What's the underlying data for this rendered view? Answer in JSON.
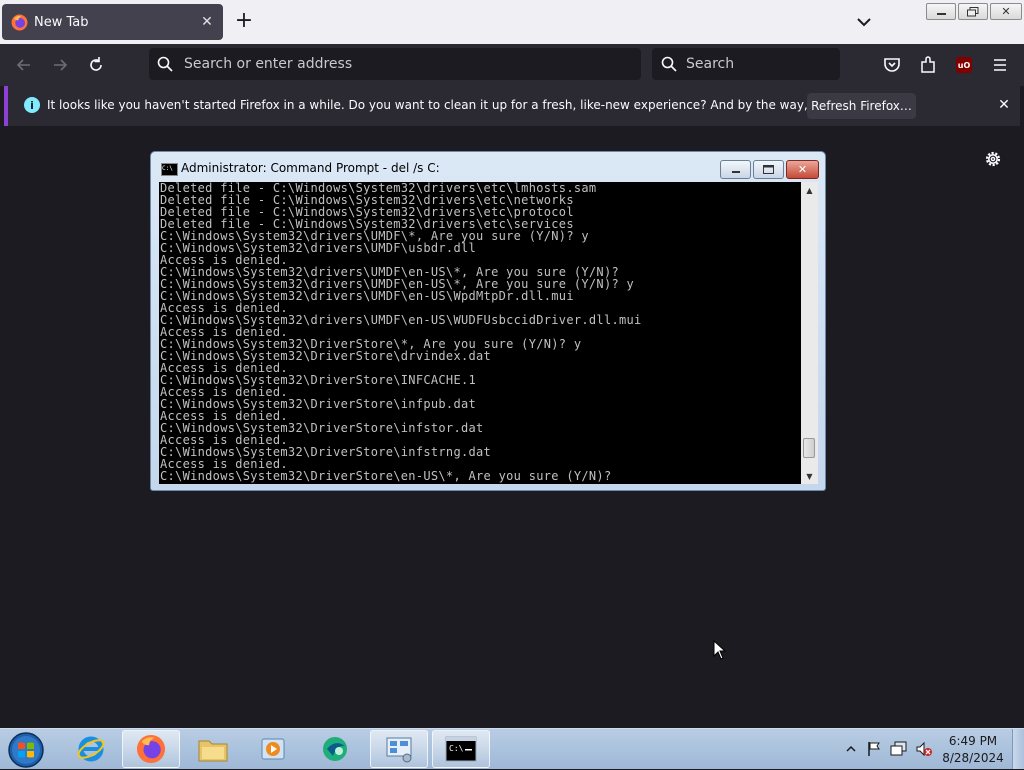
{
  "browser": {
    "tab": {
      "title": "New Tab"
    },
    "urlbar": {
      "placeholder": "Search or enter address"
    },
    "searchbar": {
      "placeholder": "Search"
    },
    "ublock_label": "uO",
    "notification": {
      "message": "It looks like you haven't started Firefox in a while. Do you want to clean it up for a fresh, like-new experience? And by the way, welcome back!",
      "button_label": "Refresh Firefox…"
    },
    "accent_color": "#8e3fd6"
  },
  "cmd_window": {
    "title": "Administrator:  Command Prompt - del  /s C:",
    "lines": [
      "Deleted file - C:\\Windows\\System32\\drivers\\etc\\lmhosts.sam",
      "Deleted file - C:\\Windows\\System32\\drivers\\etc\\networks",
      "Deleted file - C:\\Windows\\System32\\drivers\\etc\\protocol",
      "Deleted file - C:\\Windows\\System32\\drivers\\etc\\services",
      "C:\\Windows\\System32\\drivers\\UMDF\\*, Are you sure (Y/N)? y",
      "C:\\Windows\\System32\\drivers\\UMDF\\usbdr.dll",
      "Access is denied.",
      "C:\\Windows\\System32\\drivers\\UMDF\\en-US\\*, Are you sure (Y/N)?",
      "C:\\Windows\\System32\\drivers\\UMDF\\en-US\\*, Are you sure (Y/N)? y",
      "C:\\Windows\\System32\\drivers\\UMDF\\en-US\\WpdMtpDr.dll.mui",
      "Access is denied.",
      "C:\\Windows\\System32\\drivers\\UMDF\\en-US\\WUDFUsbccidDriver.dll.mui",
      "Access is denied.",
      "C:\\Windows\\System32\\DriverStore\\*, Are you sure (Y/N)? y",
      "C:\\Windows\\System32\\DriverStore\\drvindex.dat",
      "Access is denied.",
      "C:\\Windows\\System32\\DriverStore\\INFCACHE.1",
      "Access is denied.",
      "C:\\Windows\\System32\\DriverStore\\infpub.dat",
      "Access is denied.",
      "C:\\Windows\\System32\\DriverStore\\infstor.dat",
      "Access is denied.",
      "C:\\Windows\\System32\\DriverStore\\infstrng.dat",
      "Access is denied.",
      "C:\\Windows\\System32\\DriverStore\\en-US\\*, Are you sure (Y/N)?"
    ],
    "scroll_position": 0.96
  },
  "taskbar": {
    "items": [
      {
        "name": "internet-explorer",
        "icon": "internet-explorer-icon"
      },
      {
        "name": "firefox",
        "icon": "firefox-icon",
        "active": true
      },
      {
        "name": "file-explorer",
        "icon": "folder-icon"
      },
      {
        "name": "media-player",
        "icon": "media-player-icon"
      },
      {
        "name": "app-green",
        "icon": "green-app-icon"
      },
      {
        "name": "control-panel",
        "icon": "control-panel-icon"
      },
      {
        "name": "command-prompt",
        "icon": "cmd-icon",
        "active": true
      }
    ],
    "clock": {
      "time": "6:49 PM",
      "date": "8/28/2024"
    }
  }
}
